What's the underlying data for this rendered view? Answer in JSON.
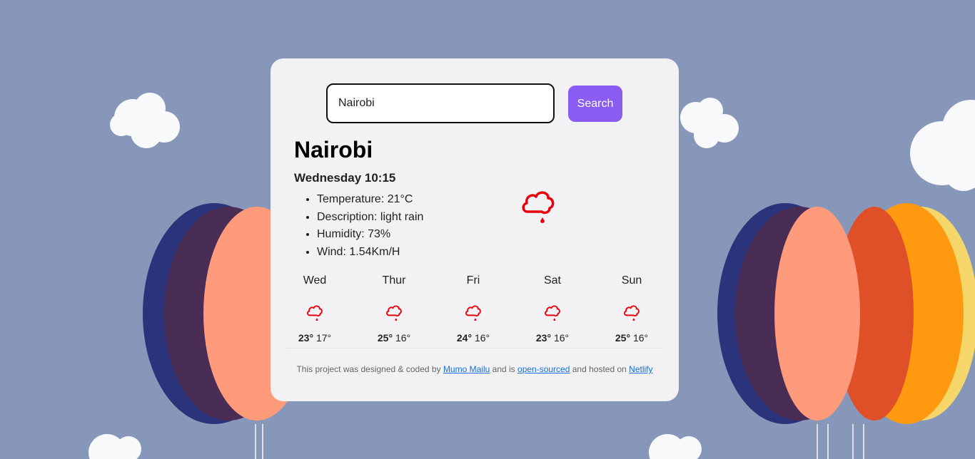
{
  "search": {
    "value": "Nairobi",
    "button_label": "Search"
  },
  "current": {
    "city": "Nairobi",
    "day_time": "Wednesday 10:15",
    "details": [
      "Temperature: 21°C",
      "Description: light rain",
      "Humidity: 73%",
      "Wind: 1.54Km/H"
    ],
    "icon": "rain-cloud-icon"
  },
  "forecast": [
    {
      "day": "Wed",
      "max": "23°",
      "min": "17°",
      "icon": "rain-cloud-icon"
    },
    {
      "day": "Thur",
      "max": "25°",
      "min": "16°",
      "icon": "rain-cloud-icon"
    },
    {
      "day": "Fri",
      "max": "24°",
      "min": "16°",
      "icon": "rain-cloud-icon"
    },
    {
      "day": "Sat",
      "max": "23°",
      "min": "16°",
      "icon": "rain-cloud-icon"
    },
    {
      "day": "Sun",
      "max": "25°",
      "min": "16°",
      "icon": "rain-cloud-icon"
    }
  ],
  "footer": {
    "text1": "This project was designed & coded by",
    "author": "Mumo Mailu",
    "text2": "and is",
    "source": "open-sourced",
    "text3": "and hosted on",
    "host": "Netlify"
  },
  "colors": {
    "accent": "#8a5cf2",
    "icon": "#e8000b",
    "link": "#1a6fd8",
    "background": "#8797b9",
    "card": "#f2f2f5"
  }
}
